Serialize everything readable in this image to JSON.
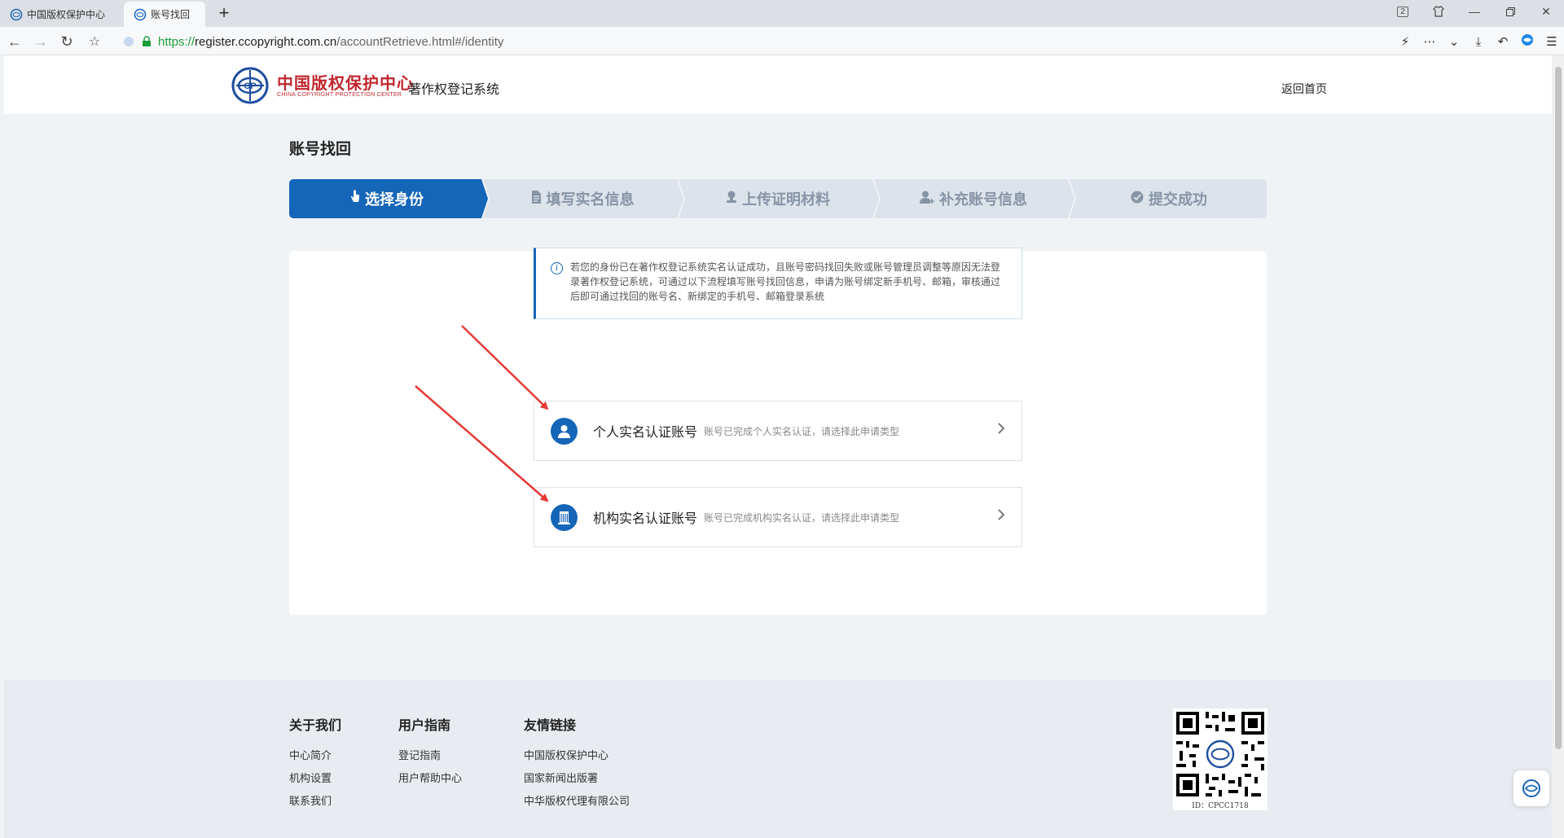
{
  "browser": {
    "tabs": [
      {
        "title": "中国版权保护中心"
      },
      {
        "title": "账号找回"
      }
    ],
    "tab_count_badge": "2",
    "url": {
      "scheme": "https://",
      "host": "register.ccopyright.com.cn",
      "path": "/accountRetrieve.html#/identity"
    }
  },
  "header": {
    "logo_cn": "中国版权保护中心",
    "logo_en": "CHINA COPYRIGHT PROTECTION CENTER",
    "system_title": "著作权登记系统",
    "back_home": "返回首页"
  },
  "page": {
    "title": "账号找回",
    "steps": [
      {
        "label": "选择身份",
        "icon": "hand-pointer-icon",
        "active": true
      },
      {
        "label": "填写实名信息",
        "icon": "document-icon",
        "active": false
      },
      {
        "label": "上传证明材料",
        "icon": "stamp-icon",
        "active": false
      },
      {
        "label": "补充账号信息",
        "icon": "user-plus-icon",
        "active": false
      },
      {
        "label": "提交成功",
        "icon": "check-circle-icon",
        "active": false
      }
    ],
    "notice": "若您的身份已在著作权登记系统实名认证成功，且账号密码找回失败或账号管理员调整等原因无法登录著作权登记系统，可通过以下流程填写账号找回信息，申请为账号绑定新手机号、邮箱，审核通过后即可通过找回的账号名、新绑定的手机号、邮箱登录系统",
    "options": [
      {
        "title": "个人实名认证账号",
        "desc": "账号已完成个人实名认证，请选择此申请类型",
        "icon": "user-icon"
      },
      {
        "title": "机构实名认证账号",
        "desc": "账号已完成机构实名认证，请选择此申请类型",
        "icon": "building-icon"
      }
    ]
  },
  "footer": {
    "columns": [
      {
        "heading": "关于我们",
        "links": [
          "中心简介",
          "机构设置",
          "联系我们"
        ]
      },
      {
        "heading": "用户指南",
        "links": [
          "登记指南",
          "用户帮助中心"
        ]
      },
      {
        "heading": "友情链接",
        "links": [
          "中国版权保护中心",
          "国家新闻出版署",
          "中华版权代理有限公司"
        ]
      }
    ],
    "qr_id": "ID：CPCC1718"
  },
  "colors": {
    "primary": "#1565b8",
    "step_inactive": "#dde3ea",
    "annotation_arrow": "#e53935",
    "logo_red": "#c1272d"
  }
}
